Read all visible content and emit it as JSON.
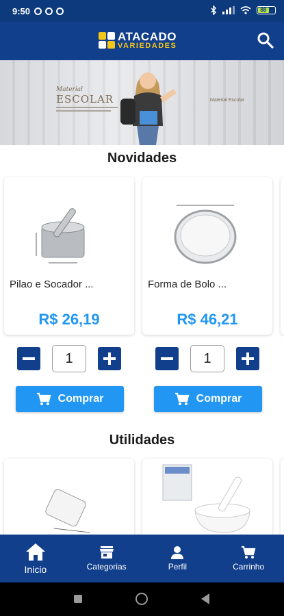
{
  "status_bar": {
    "time": "9:50",
    "battery": "88"
  },
  "app_bar": {
    "logo_line1": "ATACADO",
    "logo_line2": "VARIEDADES",
    "search_icon": "search-icon"
  },
  "banner": {
    "kicker": "Material",
    "title": "ESCOLAR",
    "badge": "Material Escolar"
  },
  "sections": {
    "novidades": "Novidades",
    "utilidades": "Utilidades"
  },
  "products": [
    {
      "name": "Pilao e Socador ...",
      "price": "R$ 26,19",
      "qty": "1",
      "buy_label": "Comprar"
    },
    {
      "name": "Forma de Bolo ...",
      "price": "R$ 46,21",
      "qty": "1",
      "buy_label": "Comprar"
    }
  ],
  "bottom_nav": [
    {
      "label": "Inicio",
      "icon": "home-icon",
      "active": true
    },
    {
      "label": "Categorias",
      "icon": "store-icon",
      "active": false
    },
    {
      "label": "Perfil",
      "icon": "person-icon",
      "active": false
    },
    {
      "label": "Carrinho",
      "icon": "cart-icon",
      "active": false
    }
  ],
  "colors": {
    "primary": "#123f8c",
    "accent": "#2196f3",
    "logo_yellow": "#f5c518"
  }
}
